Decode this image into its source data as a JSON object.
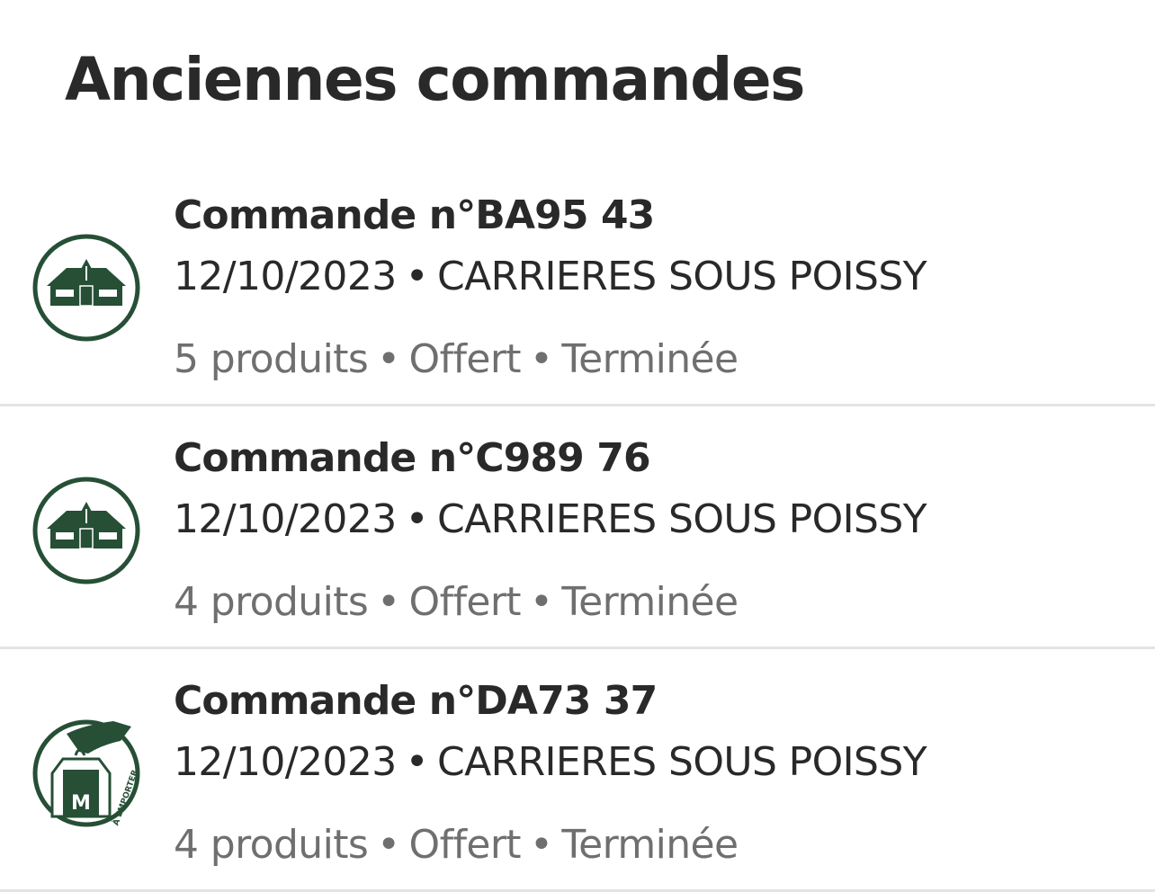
{
  "header": {
    "title": "Anciennes commandes"
  },
  "colors": {
    "brand_green": "#264f36",
    "text_primary": "#292929",
    "text_secondary": "#6f6f6f",
    "divider": "#e4e4e4"
  },
  "orders": [
    {
      "icon": "restaurant-building-icon",
      "title": "Commande n°BA95 43",
      "date": "12/10/2023",
      "location": "CARRIERES SOUS POISSY",
      "products": "5 produits",
      "price": "Offert",
      "status": "Terminée"
    },
    {
      "icon": "restaurant-building-icon",
      "title": "Commande n°C989 76",
      "date": "12/10/2023",
      "location": "CARRIERES SOUS POISSY",
      "products": "4 produits",
      "price": "Offert",
      "status": "Terminée"
    },
    {
      "icon": "takeaway-bag-icon",
      "icon_label": "À EMPORTER",
      "title": "Commande n°DA73 37",
      "date": "12/10/2023",
      "location": "CARRIERES SOUS POISSY",
      "products": "4 produits",
      "price": "Offert",
      "status": "Terminée"
    }
  ]
}
